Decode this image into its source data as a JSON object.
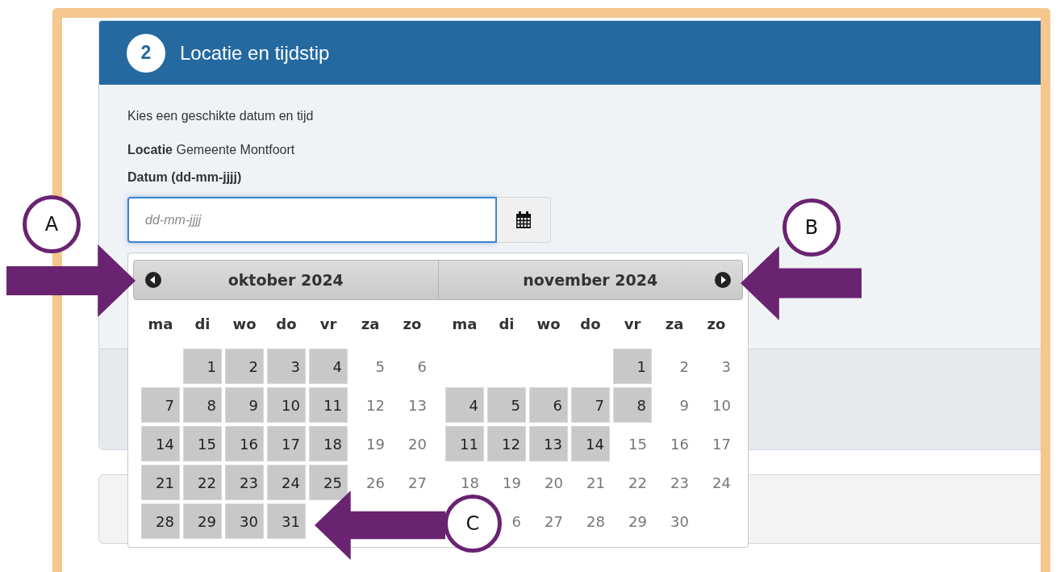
{
  "step": {
    "number": "2",
    "title": "Locatie en tijdstip"
  },
  "intro": "Kies een geschikte datum en tijd",
  "location": {
    "label": "Locatie",
    "value": "Gemeente Montfoort"
  },
  "date_field": {
    "label": "Datum (dd-mm-jjjj)",
    "placeholder": "dd-mm-jjjj",
    "focused": true
  },
  "datepicker": {
    "months": [
      {
        "title": "oktober 2024",
        "weekdays": [
          "ma",
          "di",
          "wo",
          "do",
          "vr",
          "za",
          "zo"
        ],
        "weeks": [
          {
            "tue": {
              "day": "1",
              "available": true
            },
            "wed": {
              "day": "2",
              "available": true
            },
            "thu": {
              "day": "3",
              "available": true
            },
            "fri": {
              "day": "4",
              "available": true
            },
            "sat": {
              "day": "5",
              "available": false
            },
            "sun": {
              "day": "6",
              "available": false
            }
          },
          {
            "mon": {
              "day": "7",
              "available": true
            },
            "tue": {
              "day": "8",
              "available": true
            },
            "wed": {
              "day": "9",
              "available": true
            },
            "thu": {
              "day": "10",
              "available": true
            },
            "fri": {
              "day": "11",
              "available": true
            },
            "sat": {
              "day": "12",
              "available": false
            },
            "sun": {
              "day": "13",
              "available": false
            }
          },
          {
            "mon": {
              "day": "14",
              "available": true
            },
            "tue": {
              "day": "15",
              "available": true
            },
            "wed": {
              "day": "16",
              "available": true
            },
            "thu": {
              "day": "17",
              "available": true
            },
            "fri": {
              "day": "18",
              "available": true
            },
            "sat": {
              "day": "19",
              "available": false
            },
            "sun": {
              "day": "20",
              "available": false
            }
          },
          {
            "mon": {
              "day": "21",
              "available": true
            },
            "tue": {
              "day": "22",
              "available": true
            },
            "wed": {
              "day": "23",
              "available": true
            },
            "thu": {
              "day": "24",
              "available": true
            },
            "fri": {
              "day": "25",
              "available": true
            },
            "sat": {
              "day": "26",
              "available": false
            },
            "sun": {
              "day": "27",
              "available": false
            }
          },
          {
            "mon": {
              "day": "28",
              "available": true
            },
            "tue": {
              "day": "29",
              "available": true
            },
            "wed": {
              "day": "30",
              "available": true
            },
            "thu": {
              "day": "31",
              "available": true
            }
          }
        ]
      },
      {
        "title": "november 2024",
        "weekdays": [
          "ma",
          "di",
          "wo",
          "do",
          "vr",
          "za",
          "zo"
        ],
        "weeks": [
          {
            "fri": {
              "day": "1",
              "available": true
            },
            "sat": {
              "day": "2",
              "available": false
            },
            "sun": {
              "day": "3",
              "available": false
            }
          },
          {
            "mon": {
              "day": "4",
              "available": true
            },
            "tue": {
              "day": "5",
              "available": true
            },
            "wed": {
              "day": "6",
              "available": true
            },
            "thu": {
              "day": "7",
              "available": true
            },
            "fri": {
              "day": "8",
              "available": true
            },
            "sat": {
              "day": "9",
              "available": false
            },
            "sun": {
              "day": "10",
              "available": false
            }
          },
          {
            "mon": {
              "day": "11",
              "available": true
            },
            "tue": {
              "day": "12",
              "available": true
            },
            "wed": {
              "day": "13",
              "available": true
            },
            "thu": {
              "day": "14",
              "available": true
            },
            "fri": {
              "day": "15",
              "available": false
            },
            "sat": {
              "day": "16",
              "available": false
            },
            "sun": {
              "day": "17",
              "available": false
            }
          },
          {
            "mon": {
              "day": "18",
              "available": false
            },
            "tue": {
              "day": "19",
              "available": false
            },
            "wed": {
              "day": "20",
              "available": false
            },
            "thu": {
              "day": "21",
              "available": false
            },
            "fri": {
              "day": "22",
              "available": false
            },
            "sat": {
              "day": "23",
              "available": false
            },
            "sun": {
              "day": "24",
              "available": false
            }
          },
          {
            "tue": {
              "day": "6",
              "available": false
            },
            "wed": {
              "day": "27",
              "available": false
            },
            "thu": {
              "day": "28",
              "available": false
            },
            "fri": {
              "day": "29",
              "available": false
            },
            "sat": {
              "day": "30",
              "available": false
            }
          }
        ]
      }
    ]
  },
  "annotations": [
    {
      "label": "A",
      "kind": "right"
    },
    {
      "label": "B",
      "kind": "left"
    },
    {
      "label": "C",
      "kind": "left"
    }
  ]
}
